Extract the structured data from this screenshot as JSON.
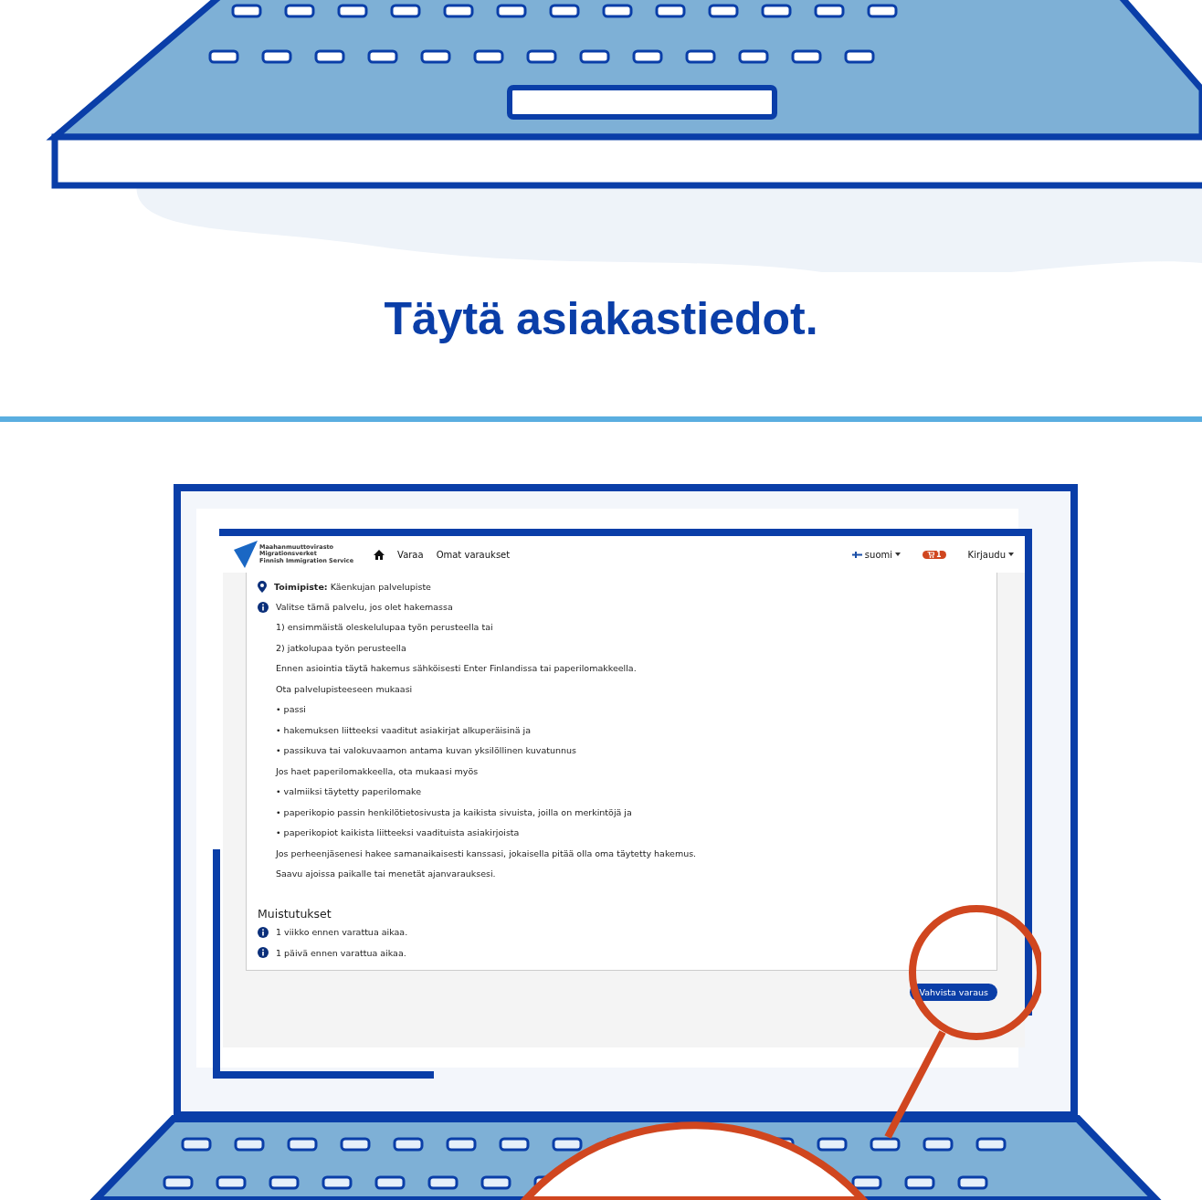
{
  "heading": "Täytä asiakastiedot.",
  "screen": {
    "logo_lines": [
      "Maahanmuuttovirasto",
      "Migrationsverket",
      "Finnish Immigration Service"
    ],
    "nav": [
      {
        "label": "Varaa"
      },
      {
        "label": "Omat varaukset"
      }
    ],
    "language": "suomi",
    "cart_count": "1",
    "login": "Kirjaudu",
    "office": "**Toimipiste:** Käenkujan palvelupiste",
    "info_title": "Valitse tämä palvelu, jos olet hakemassa",
    "info_lines": [
      "1) ensimmäistä oleskelulupaa työn perusteella tai",
      "2) jatkolupaa työn perusteella",
      "Ennen asiointia täytä hakemus sähköisesti Enter Finlandissa tai paperilomakkeella.",
      "Ota palvelupisteeseen mukaasi",
      "• passi",
      "• hakemuksen liitteeksi vaaditut asiakirjat alkuperäisinä ja",
      "• passikuva tai valokuvaamon antama kuvan yksilöllinen kuvatunnus",
      "Jos haet paperilomakkeella, ota mukaasi myös",
      "• valmiiksi täytetty paperilomake",
      "• paperikopio passin henkilötietosivusta ja kaikista sivuista, joilla on merkintöjä ja",
      "• paperikopiot kaikista liitteeksi vaadituista asiakirjoista",
      "Jos perheenjäsenesi hakee samanaikaisesti kanssasi, jokaisella pitää olla oma täytetty hakemus.",
      "Saavu ajoissa paikalle tai menetät ajanvarauksesi."
    ],
    "reminders_title": "Muistutukset",
    "reminders": [
      "1 viikko ennen varattua aikaa.",
      "1 päivä ennen varattua aikaa."
    ],
    "confirm_button": "Vahvista varaus"
  }
}
